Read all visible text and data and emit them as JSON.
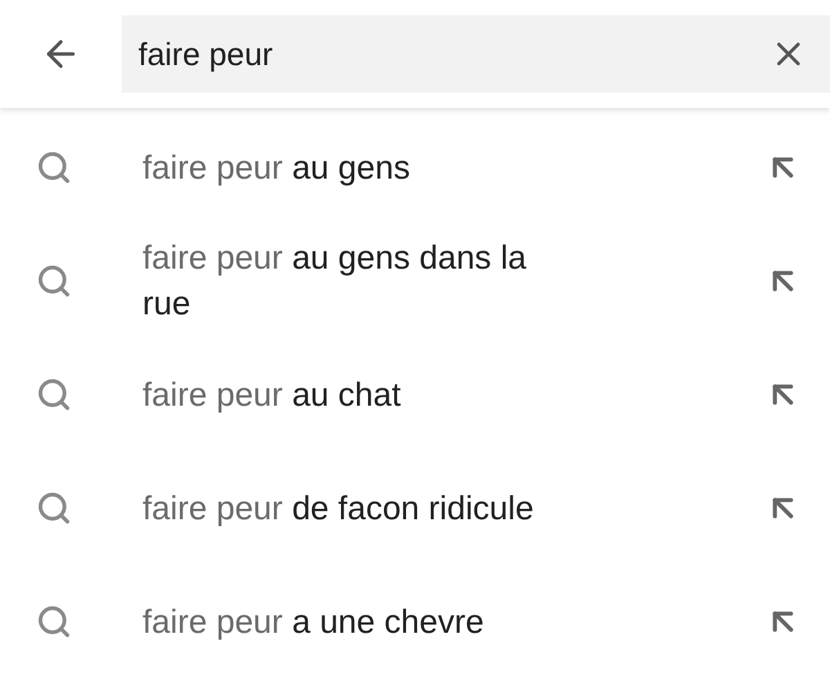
{
  "search": {
    "value": "faire peur"
  },
  "suggestions": [
    {
      "prefix": "faire peur",
      "completion": "au gens"
    },
    {
      "prefix": "faire peur",
      "completion": "au gens dans la rue"
    },
    {
      "prefix": "faire peur",
      "completion": "au chat"
    },
    {
      "prefix": "faire peur",
      "completion": "de facon ridicule"
    },
    {
      "prefix": "faire peur",
      "completion": "a une chevre"
    }
  ]
}
